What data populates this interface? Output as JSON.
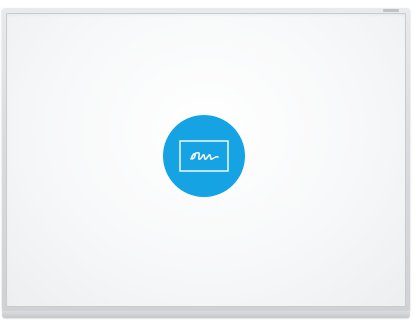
{
  "board": {
    "surface_color": "#ffffff",
    "frame_color": "#d9dbde"
  },
  "signature_badge": {
    "icon": "signature-icon",
    "background_color": "#16a3e3",
    "icon_color": "#ffffff"
  }
}
